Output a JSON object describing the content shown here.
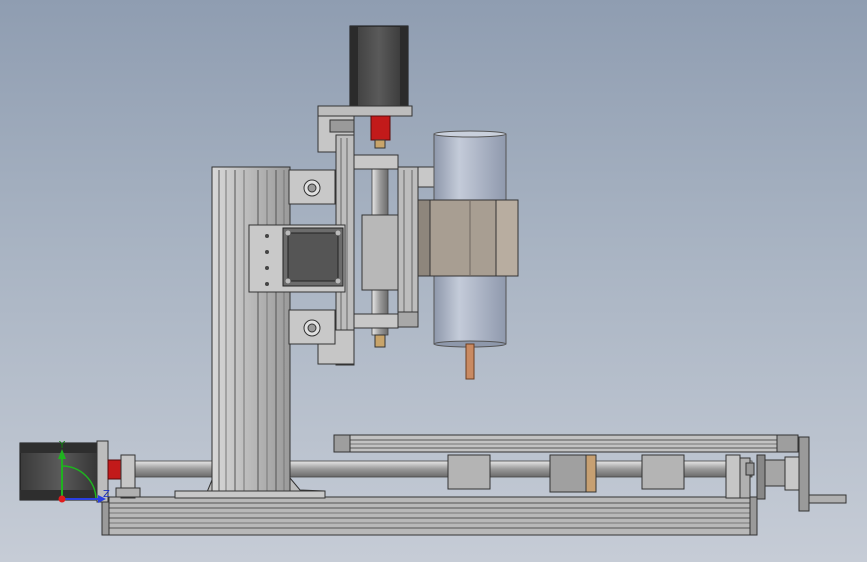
{
  "view": {
    "background_top": "#8f9db1",
    "background_bottom": "#c6ccd6"
  },
  "triad": {
    "y_label": "Y",
    "z_label": "Z",
    "y_color": "#1fb31f",
    "z_color": "#2a3fe0",
    "x_color": "#e01c1c"
  },
  "colors": {
    "metal_light": "#c9c9c9",
    "metal_mid": "#a8a8a8",
    "metal_dark": "#6e6e6e",
    "motor_body": "#4a4a4a",
    "coupler_red": "#c21a1a",
    "spindle_blue": "#a8b3c7",
    "brass": "#c8a46a",
    "copper": "#c98a62"
  }
}
